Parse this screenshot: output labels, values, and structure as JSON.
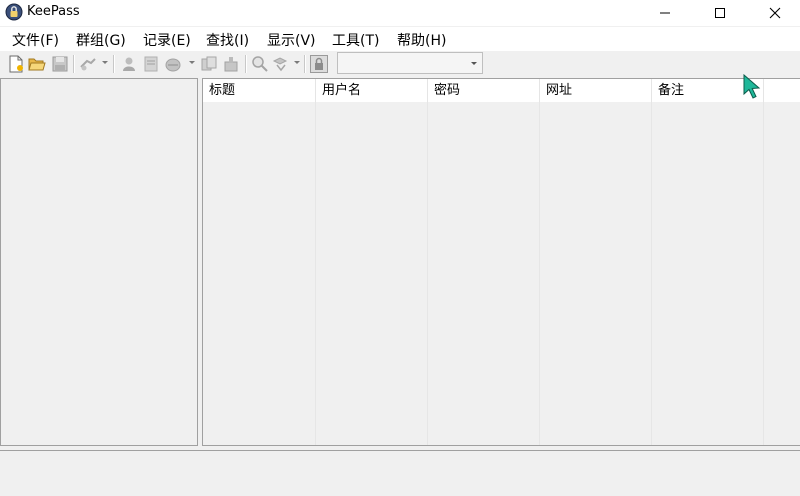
{
  "window": {
    "title": "KeePass"
  },
  "menu": {
    "file": "文件(F)",
    "group": "群组(G)",
    "entry": "记录(E)",
    "find": "查找(I)",
    "view": "显示(V)",
    "tools": "工具(T)",
    "help": "帮助(H)"
  },
  "toolbar": {
    "icons": [
      "new-database-icon",
      "open-database-icon",
      "save-database-icon",
      "sync-icon",
      "add-entry-icon",
      "edit-entry-icon",
      "delete-entry-icon",
      "copy-username-icon",
      "copy-password-icon",
      "find-icon",
      "sort-icon",
      "lock-workspace-icon"
    ],
    "quick_find_value": ""
  },
  "entry_list": {
    "columns": [
      "标题",
      "用户名",
      "密码",
      "网址",
      "备注"
    ],
    "rows": []
  },
  "colors": {
    "title_bar": "#ffffff",
    "window_bg": "#f0f0f0",
    "cursor": "#1fb89a"
  }
}
